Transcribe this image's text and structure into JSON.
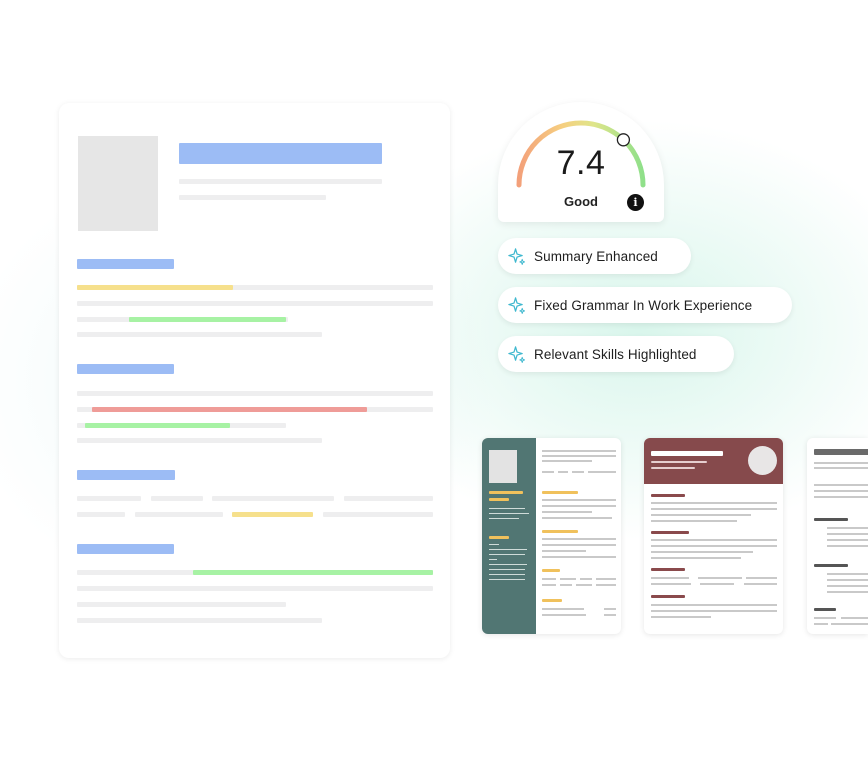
{
  "score": {
    "value": "7.4",
    "label": "Good",
    "level_fraction": 0.74,
    "info_glyph": "i"
  },
  "improvements": [
    {
      "label": "Summary Enhanced",
      "icon": "sparkle-icon"
    },
    {
      "label": "Fixed Grammar In Work Experience",
      "icon": "sparkle-icon"
    },
    {
      "label": "Relevant Skills Highlighted",
      "icon": "sparkle-icon"
    }
  ],
  "colors": {
    "heading_blue": "#9cbcf5",
    "highlight_yellow": "#f6e08c",
    "highlight_green": "#a7f2a4",
    "highlight_red": "#ef9c98",
    "template1_sidebar": "#517673",
    "template2_header": "#864a4c",
    "sparkle_teal": "#3fb8cf"
  },
  "templates": [
    {
      "name": "template-teal-sidebar"
    },
    {
      "name": "template-maroon-header"
    },
    {
      "name": "template-classic"
    }
  ]
}
